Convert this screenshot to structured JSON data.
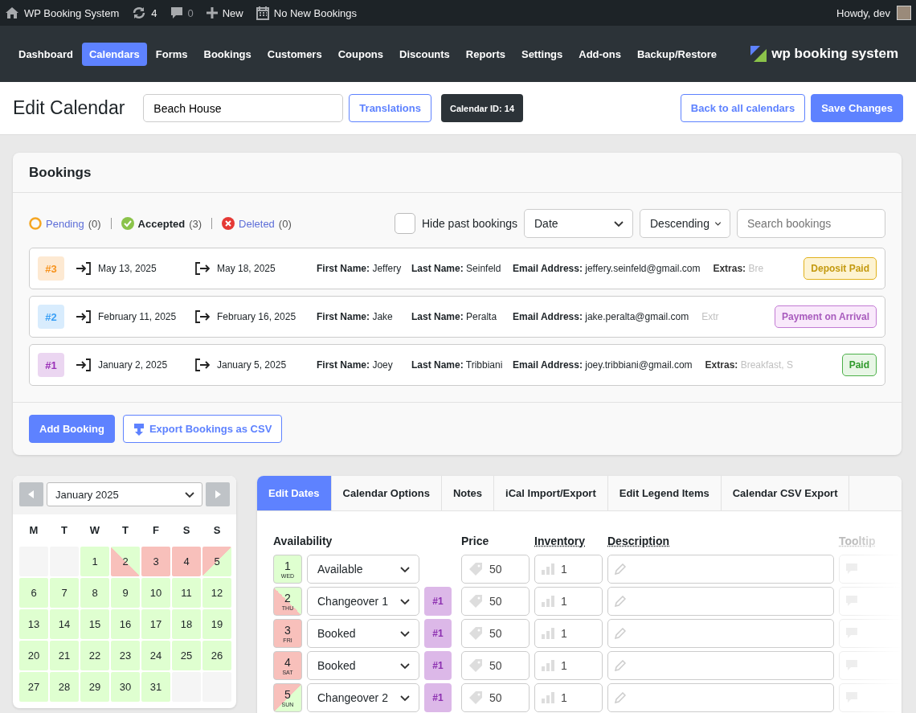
{
  "admin_bar": {
    "site": "WP Booking System",
    "updates": "4",
    "comments": "0",
    "new": "New",
    "bookings_notice": "No New Bookings",
    "greeting": "Howdy, dev"
  },
  "nav": {
    "items": [
      {
        "label": "Dashboard",
        "selected": false
      },
      {
        "label": "Calendars",
        "selected": true
      },
      {
        "label": "Forms",
        "selected": false
      },
      {
        "label": "Bookings",
        "selected": false
      },
      {
        "label": "Customers",
        "selected": false
      },
      {
        "label": "Coupons",
        "selected": false
      },
      {
        "label": "Discounts",
        "selected": false
      },
      {
        "label": "Reports",
        "selected": false
      },
      {
        "label": "Settings",
        "selected": false
      },
      {
        "label": "Add-ons",
        "selected": false
      },
      {
        "label": "Backup/Restore",
        "selected": false
      }
    ],
    "logo": "wp booking system"
  },
  "header": {
    "title": "Edit Calendar",
    "name_value": "Beach House",
    "translations": "Translations",
    "calendar_id": "Calendar ID: 14",
    "back": "Back to all calendars",
    "save": "Save Changes"
  },
  "bookings": {
    "title": "Bookings",
    "statuses": [
      {
        "kind": "pending",
        "label": "Pending",
        "count": "(0)",
        "selected": false
      },
      {
        "kind": "accepted",
        "label": "Accepted",
        "count": "(3)",
        "selected": true
      },
      {
        "kind": "deleted",
        "label": "Deleted",
        "count": "(0)",
        "selected": false
      }
    ],
    "hide_past": {
      "label": "Hide past bookings",
      "checked": false
    },
    "sort_by": "Date",
    "order": "Descending",
    "search": {
      "placeholder": "Search bookings"
    },
    "rows": [
      {
        "id": "#3",
        "color": "#f7931e",
        "check_in": "May 13, 2025",
        "check_out": "May 18, 2025",
        "first_name_label": "First Name:",
        "first_name": "Jeffery",
        "last_name_label": "Last Name:",
        "last_name": "Seinfeld",
        "email_label": "Email Address:",
        "email": "jeffery.seinfeld@gmail.com",
        "extras_label": "Extras:",
        "extras": "Bre",
        "payment": {
          "kind": "deposit",
          "label": "Deposit Paid"
        }
      },
      {
        "id": "#2",
        "color": "#3ba0f5",
        "check_in": "February 11, 2025",
        "check_out": "February 16, 2025",
        "first_name_label": "First Name:",
        "first_name": "Jake",
        "last_name_label": "Last Name:",
        "last_name": "Peralta",
        "email_label": "Email Address:",
        "email": "jake.peralta@gmail.com",
        "extras_label": "Extr",
        "payment": {
          "kind": "arrival",
          "label": "Payment on Arrival"
        }
      },
      {
        "id": "#1",
        "color": "#9b30b8",
        "check_in": "January 2, 2025",
        "check_out": "January 5, 2025",
        "first_name_label": "First Name:",
        "first_name": "Joey",
        "last_name_label": "Last Name:",
        "last_name": "Tribbiani",
        "email_label": "Email Address:",
        "email": "joey.tribbiani@gmail.com",
        "extras_label": "Extras:",
        "extras": "Breakfast, S",
        "payment": {
          "kind": "paid",
          "label": "Paid"
        }
      }
    ],
    "add": "Add Booking",
    "export": "Export Bookings as CSV"
  },
  "calendar": {
    "month": "January 2025",
    "weekdays": [
      "M",
      "T",
      "W",
      "T",
      "F",
      "S",
      "S"
    ],
    "cells": [
      {
        "kind": "blank"
      },
      {
        "kind": "blank"
      },
      {
        "day": "1",
        "kind": "available"
      },
      {
        "day": "2",
        "kind": "changeover1"
      },
      {
        "day": "3",
        "kind": "booked"
      },
      {
        "day": "4",
        "kind": "booked"
      },
      {
        "day": "5",
        "kind": "changeover2"
      },
      {
        "day": "6",
        "kind": "available"
      },
      {
        "day": "7",
        "kind": "available"
      },
      {
        "day": "8",
        "kind": "available"
      },
      {
        "day": "9",
        "kind": "available"
      },
      {
        "day": "10",
        "kind": "available"
      },
      {
        "day": "11",
        "kind": "available"
      },
      {
        "day": "12",
        "kind": "available"
      },
      {
        "day": "13",
        "kind": "available"
      },
      {
        "day": "14",
        "kind": "available"
      },
      {
        "day": "15",
        "kind": "available"
      },
      {
        "day": "16",
        "kind": "available"
      },
      {
        "day": "17",
        "kind": "available"
      },
      {
        "day": "18",
        "kind": "available"
      },
      {
        "day": "19",
        "kind": "available"
      },
      {
        "day": "20",
        "kind": "available"
      },
      {
        "day": "21",
        "kind": "available"
      },
      {
        "day": "22",
        "kind": "available"
      },
      {
        "day": "23",
        "kind": "available"
      },
      {
        "day": "24",
        "kind": "available"
      },
      {
        "day": "25",
        "kind": "available"
      },
      {
        "day": "26",
        "kind": "available"
      },
      {
        "day": "27",
        "kind": "available"
      },
      {
        "day": "28",
        "kind": "available"
      },
      {
        "day": "29",
        "kind": "available"
      },
      {
        "day": "30",
        "kind": "available"
      },
      {
        "day": "31",
        "kind": "available"
      },
      {
        "kind": "blank"
      },
      {
        "kind": "blank"
      }
    ]
  },
  "edit_panel": {
    "tabs": [
      {
        "label": "Edit Dates",
        "selected": true
      },
      {
        "label": "Calendar Options",
        "selected": false
      },
      {
        "label": "Notes",
        "selected": false
      },
      {
        "label": "iCal Import/Export",
        "selected": false
      },
      {
        "label": "Edit Legend Items",
        "selected": false
      },
      {
        "label": "Calendar CSV Export",
        "selected": false
      }
    ],
    "columns": {
      "availability": "Availability",
      "price": "Price",
      "inventory": "Inventory",
      "description": "Description",
      "tooltip": "Tooltip"
    },
    "rows": [
      {
        "day": "1",
        "weekday": "WED",
        "kind": "available",
        "status": "Available",
        "price": "50",
        "inventory": "1"
      },
      {
        "day": "2",
        "weekday": "THU",
        "kind": "changeover1",
        "status": "Changeover 1",
        "booking": "#1",
        "price": "50",
        "inventory": "1"
      },
      {
        "day": "3",
        "weekday": "FRI",
        "kind": "booked",
        "status": "Booked",
        "booking": "#1",
        "price": "50",
        "inventory": "1"
      },
      {
        "day": "4",
        "weekday": "SAT",
        "kind": "booked",
        "status": "Booked",
        "booking": "#1",
        "price": "50",
        "inventory": "1"
      },
      {
        "day": "5",
        "weekday": "SUN",
        "kind": "changeover2",
        "status": "Changeover 2",
        "booking": "#1",
        "price": "50",
        "inventory": "1"
      }
    ]
  }
}
